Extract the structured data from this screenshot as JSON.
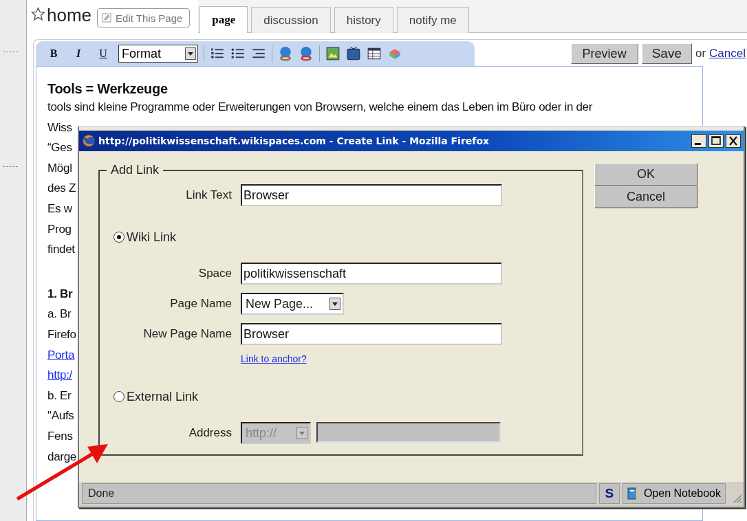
{
  "page": {
    "title": "home",
    "edit_button": "Edit This Page",
    "tabs": [
      {
        "label": "page",
        "selected": true
      },
      {
        "label": "discussion",
        "selected": false
      },
      {
        "label": "history",
        "selected": false
      },
      {
        "label": "notify me",
        "selected": false
      }
    ],
    "toolbar": {
      "style_buttons": [
        "B",
        "I",
        "U"
      ],
      "format": "Format"
    },
    "actions": {
      "preview": "Preview",
      "save": "Save",
      "or": "or",
      "cancel": "Cancel"
    },
    "content": {
      "heading": "Tools = Werkzeuge",
      "lines": [
        {
          "kind": "plain",
          "text": "tools sind kleine Programme oder Erweiterungen von Browsern, welche einem das Leben im Büro oder in der"
        },
        {
          "kind": "plain",
          "text": "Wiss"
        },
        {
          "kind": "plain",
          "text": "“Ges"
        },
        {
          "kind": "plain",
          "text": "Mögl"
        },
        {
          "kind": "plain",
          "text": "des Z"
        },
        {
          "kind": "plain",
          "text": "Es w"
        },
        {
          "kind": "plain",
          "text": "Prog"
        },
        {
          "kind": "plain",
          "text": "findet"
        },
        {
          "kind": "bold",
          "text": "1. Br",
          "gap_before": true
        },
        {
          "kind": "plain",
          "text": "a. Br"
        },
        {
          "kind": "plain",
          "text": "Firefo"
        },
        {
          "kind": "link",
          "text": "Porta"
        },
        {
          "kind": "link",
          "text": "http:/"
        },
        {
          "kind": "plain",
          "text": "b. Er"
        },
        {
          "kind": "plain",
          "text": "\"Aufs"
        },
        {
          "kind": "plain",
          "text": "Fens"
        },
        {
          "kind": "plain",
          "text": "darge"
        }
      ]
    }
  },
  "dialog": {
    "title": "http://politikwissenschaft.wikispaces.com - Create Link - Mozilla Firefox",
    "legend": "Add Link",
    "rows": [
      {
        "kind": "text",
        "label": "Link Text",
        "value": "Browser"
      },
      {
        "kind": "radio",
        "label": "Wiki Link",
        "selected": true
      },
      {
        "kind": "text",
        "label": "Space",
        "value": "politikwissenschaft"
      },
      {
        "kind": "select",
        "label": "Page Name",
        "value": "New Page..."
      },
      {
        "kind": "text",
        "label": "New Page Name",
        "value": "Browser"
      },
      {
        "kind": "link",
        "label": "Link to anchor?"
      },
      {
        "kind": "radio",
        "label": "External Link",
        "selected": false
      },
      {
        "kind": "address",
        "label": "Address",
        "value": "http://",
        "disabled": true
      }
    ],
    "buttons": [
      "OK",
      "Cancel"
    ],
    "status": {
      "text": "Done",
      "badge": "S",
      "addon": "Open Notebook"
    }
  }
}
